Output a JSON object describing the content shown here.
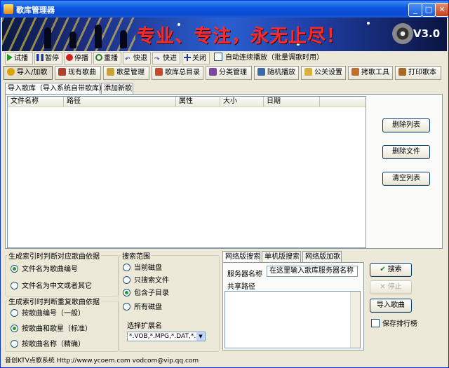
{
  "window": {
    "title": "歌库管理器",
    "controls": {
      "minimize": "_",
      "maximize": "□",
      "close": "✕"
    }
  },
  "banner": {
    "slogan": "专业、专注，永无止尽！",
    "version": "V3.0"
  },
  "playback": {
    "buttons": [
      {
        "label": "试播",
        "icon": "play-icon"
      },
      {
        "label": "暂停",
        "icon": "pause-icon"
      },
      {
        "label": "停播",
        "icon": "stop-icon"
      },
      {
        "label": "重播",
        "icon": "replay-icon"
      },
      {
        "label": "快退",
        "icon": "rewind-icon"
      },
      {
        "label": "快进",
        "icon": "fast-forward-icon"
      },
      {
        "label": "关闭",
        "icon": "close-icon"
      }
    ],
    "auto_play_label": "自动连续播放（批量调歌时用）"
  },
  "main_nav": [
    {
      "label": "导入/加歌",
      "icon": "import-icon",
      "color": "#d9a400"
    },
    {
      "label": "现有歌曲",
      "icon": "songs-icon",
      "color": "#b0402a"
    },
    {
      "label": "歌星管理",
      "icon": "singer-icon",
      "color": "#caa23a"
    },
    {
      "label": "歌库总目录",
      "icon": "catalog-icon",
      "color": "#c64a2a"
    },
    {
      "label": "分类管理",
      "icon": "category-icon",
      "color": "#7a4aa0"
    },
    {
      "label": "随机播放",
      "icon": "random-play-icon",
      "color": "#3a6aa8"
    },
    {
      "label": "公关设置",
      "icon": "settings-icon",
      "color": "#d8b040"
    },
    {
      "label": "拷歌工具",
      "icon": "copy-tool-icon",
      "color": "#c0702a"
    },
    {
      "label": "打印歌本",
      "icon": "print-icon",
      "color": "#a86a2a"
    }
  ],
  "sub_tabs": [
    "导入歌库（导入系统自带歌库）",
    "添加新歌"
  ],
  "file_list": {
    "columns": [
      "文件名称",
      "路径",
      "属性",
      "大小",
      "日期"
    ],
    "rows": []
  },
  "side_buttons": [
    "删除列表",
    "删除文件",
    "清空列表"
  ],
  "index_basis": {
    "legend": "生成索引时判断对应歌曲依据",
    "options": [
      "文件名为歌曲编号",
      "文件名为中文或者其它"
    ],
    "selected": 0
  },
  "dup_basis": {
    "legend": "生成索引时判断重复歌曲依据",
    "options": [
      "按歌曲编号（一般）",
      "按歌曲和歌星（标准）",
      "按歌曲名称（精确）"
    ],
    "selected": 1
  },
  "search_scope": {
    "legend": "搜索范围",
    "options": [
      "当前磁盘",
      "只搜索文件",
      "包含子目录",
      "所有磁盘"
    ],
    "selected": 2,
    "ext_label": "选择扩展名",
    "ext_value": "*.VOB,*.MPG,*.DAT,*.M"
  },
  "net_tabs": [
    "网络版搜索",
    "单机版搜索",
    "网络版加歌"
  ],
  "net_search": {
    "server_label": "服务器名称",
    "server_value": "在这里输入歌库服务器名称",
    "share_label": "共享路径",
    "share_value": ""
  },
  "actions": {
    "search": "搜索",
    "stop": "停止",
    "import": "导入歌曲",
    "save_ranking": "保存排行榜"
  },
  "status": "音创KTV点歌系统 Http://www.ycoem.com vodcom@vip.qq.com"
}
